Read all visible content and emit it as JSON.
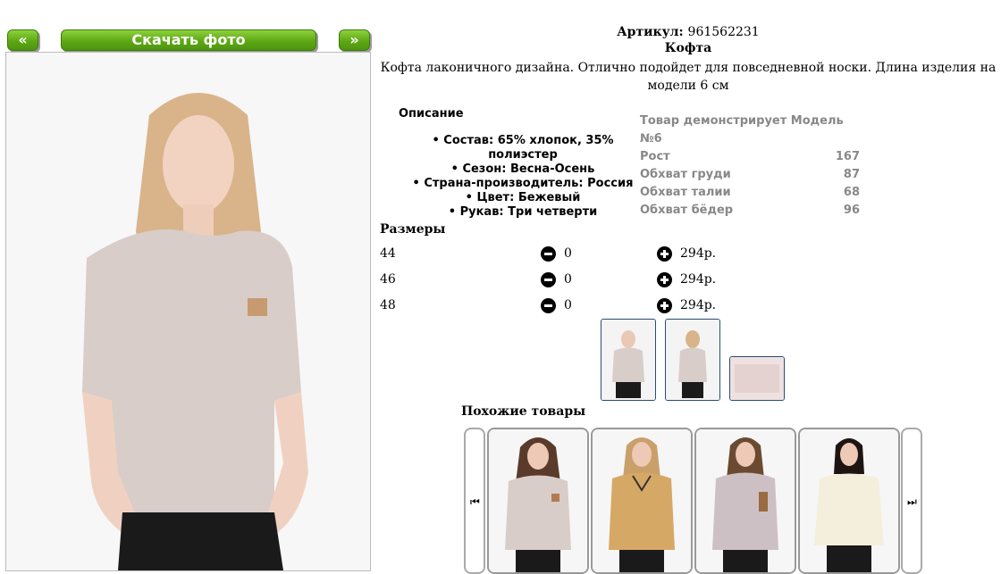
{
  "nav": {
    "prev_label": "«",
    "download_label": "Скачать фото",
    "next_label": "»"
  },
  "product": {
    "article_label": "Артикул:",
    "article_value": "961562231",
    "title": "Кофта",
    "description": "Кофта лаконичного дизайна. Отлично подойдет для повседневной носки. Длина изделия на модели 6 см"
  },
  "description_section": {
    "heading": "Описание",
    "items": [
      "Состав: 65% хлопок, 35% полиэстер",
      "Сезон: Весна-Осень",
      "Страна-производитель: Россия",
      "Цвет: Бежевый",
      "Рукав: Три четверти"
    ]
  },
  "model": {
    "heading": "Товар демонстрирует Модель №6",
    "rows": [
      {
        "label": "Рост",
        "value": "167"
      },
      {
        "label": "Обхват груди",
        "value": "87"
      },
      {
        "label": "Обхват талии",
        "value": "68"
      },
      {
        "label": "Обхват бёдер",
        "value": "96"
      }
    ]
  },
  "sizes": {
    "heading": "Размеры",
    "rows": [
      {
        "size": "44",
        "qty": "0",
        "price": "294р."
      },
      {
        "size": "46",
        "qty": "0",
        "price": "294р."
      },
      {
        "size": "48",
        "qty": "0",
        "price": "294р."
      }
    ]
  },
  "similar": {
    "heading": "Похожие товары"
  },
  "icons": {
    "minus": "minus-circle-icon",
    "plus": "plus-circle-icon",
    "prev": "skip-back-icon",
    "next": "skip-forward-icon"
  },
  "colors": {
    "button_green": "#5da813",
    "thumb_border": "#2b4a7a",
    "model_text": "#888888"
  }
}
